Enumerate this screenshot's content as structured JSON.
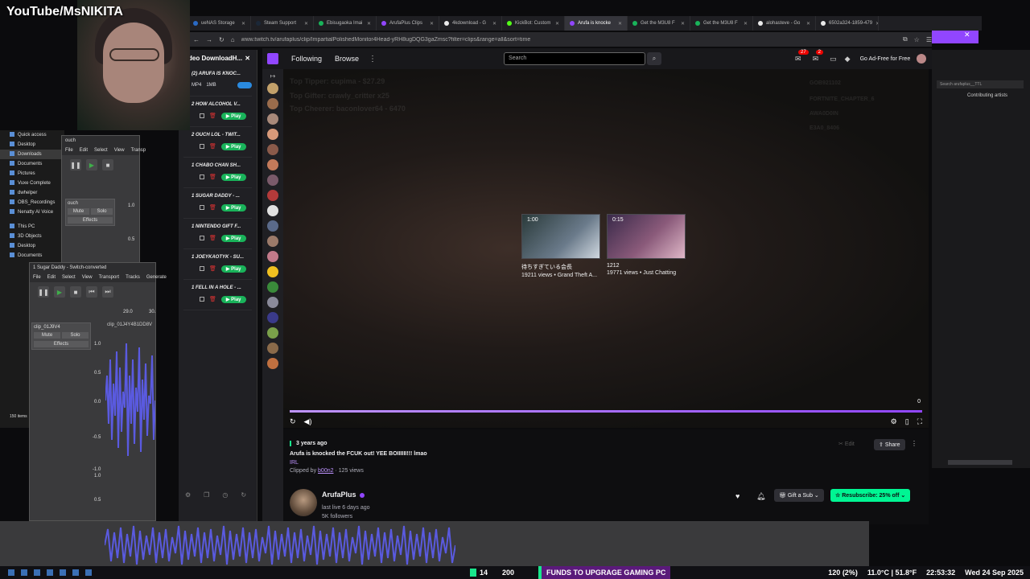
{
  "overlay": {
    "title": "YouTube/MsNIKITA"
  },
  "explorer": {
    "items": [
      "Quick access",
      "Desktop",
      "Downloads",
      "Documents",
      "Pictures",
      "Vuxe Complete",
      "dwhelper",
      "OBS_Recordings",
      "Nenatty AI Voice",
      "This PC",
      "3D Objects",
      "Desktop",
      "Documents"
    ],
    "footer": "150 items"
  },
  "audacity_small": {
    "title": "ouch",
    "menu": [
      "File",
      "Edit",
      "Select",
      "View",
      "Transp"
    ],
    "track_name": "ouch",
    "mute": "Mute",
    "solo": "Solo",
    "effects": "Effects",
    "scale_top": "1.0",
    "scale_mid": "0.5"
  },
  "audacity_large": {
    "title": "1 Sugar Daddy - Switch-converted",
    "menu": [
      "File",
      "Edit",
      "Select",
      "View",
      "Transport",
      "Tracks",
      "Generate"
    ],
    "track_name": "clip_01J9V4",
    "mute": "Mute",
    "solo": "Solo",
    "effects": "Effects",
    "clip_label": "clip_01J4Y4B1DD8V",
    "time_29": "29.0",
    "time_30": "30.",
    "scale": [
      "1.0",
      "0.5",
      "0.0",
      "-0.5",
      "-1.0",
      "1.0",
      "0.5",
      "0.0"
    ]
  },
  "downloader": {
    "title": "deo DownloadH...",
    "first_item": {
      "title": "(2) ARUFA IS KNOC...",
      "fmt": "MP4",
      "size": "1MB"
    },
    "play_label": "Play",
    "items": [
      "2 HOW ALCOHOL V...",
      "2 OUCH LOL - TWIT...",
      "1 CHABO CHAN SH...",
      "1 SUGAR DADDY - ...",
      "1 NINTENDO GIFT F...",
      "1 JOEYKAOTYK - SU...",
      "1 FELL IN A HOLE - ..."
    ]
  },
  "browser": {
    "tabs": [
      {
        "label": "ueNAS Storage",
        "color": "#2a6ac5"
      },
      {
        "label": "Steam Support",
        "color": "#1b2838"
      },
      {
        "label": "Ebisugaoka Imai",
        "color": "#19b35a"
      },
      {
        "label": "ArufaPlus Clips",
        "color": "#9146ff"
      },
      {
        "label": "4kdownload - G",
        "color": "#eaeaea"
      },
      {
        "label": "KickBot: Custom",
        "color": "#53fc18"
      },
      {
        "label": "Arufa is knocke",
        "color": "#9146ff"
      },
      {
        "label": "Get the M3U8 F",
        "color": "#19b35a"
      },
      {
        "label": "Get the M3U8 F",
        "color": "#19b35a"
      },
      {
        "label": "alohasteve - Go",
        "color": "#eaeaea"
      },
      {
        "label": "6502a324-1859-479",
        "color": "#eaeaea"
      }
    ],
    "url": "www.twitch.tv/arufaplus/clip/ImpartialPolishedMonitor4Head-yRH8ugDQG3gaZmsc?filter=clips&range=all&sort=time"
  },
  "twitch_nav": {
    "following": "Following",
    "browse": "Browse",
    "search_placeholder": "Search",
    "notif_count": "27",
    "inbox_count": "2",
    "adfree": "Go Ad-Free for Free"
  },
  "rail_colors": [
    "#c2a06a",
    "#9a6c4c",
    "#a8897a",
    "#d89a7a",
    "#8a5a4a",
    "#c47a5a",
    "#7a5a6a",
    "#b33a3a",
    "#e0e0e0",
    "#5a6a8a",
    "#9b7a6a",
    "#c27a8a",
    "#f0c020",
    "#3a8a3a",
    "#8a8a9a",
    "#3a3a8a",
    "#7aa04a",
    "#8a6a4a",
    "#c07040"
  ],
  "player": {
    "faint_1": "Top Tipper: cupima - $27.29",
    "faint_2": "Top Gifter: crawly_critter x25",
    "faint_3": "Top Cheerer: baconlover64 - 6470",
    "faint_r1": "GOB921102",
    "faint_r2": "FORTNITE_CHAPTER_6",
    "faint_r3": "AWA0D0IN",
    "faint_r4": "E3A0_8406",
    "clips": [
      {
        "duration": "1:00",
        "title": "待ちすぎている会長",
        "meta": "19211 views • Grand Theft A..."
      },
      {
        "duration": "0:15",
        "title": "1212",
        "meta": "19771 views • Just Chatting"
      }
    ],
    "progress_fraction": 1.0,
    "progress_count": "0"
  },
  "clip_info": {
    "ago": "3 years ago",
    "title": "Arufa is knocked the FCUK out! YEE BOIIIIII!!! lmao",
    "category": "IRL",
    "clipped_by_prefix": "Clipped by ",
    "clipped_by_user": "b00n2",
    "views": " · 125 views",
    "edit": "Edit",
    "share": "Share"
  },
  "channel": {
    "name": "ArufaPlus",
    "last_live": "last live 6 days ago",
    "followers": "5K followers",
    "gift": "Gift a Sub",
    "resub": "Resubscribe: 25% off"
  },
  "right_panel": {
    "search_placeholder": "Search arufaplus__TTL",
    "contrib": "Contributing artists"
  },
  "taskbar": {
    "viewers": "14",
    "viewers2": "200",
    "goal": "FUNDS TO UPGRAGE GAMING PC",
    "cpu": "120 (2%)",
    "weather": "11.0°C | 51.8°F",
    "time": "22:53:32",
    "date": "Wed 24 Sep 2025"
  }
}
